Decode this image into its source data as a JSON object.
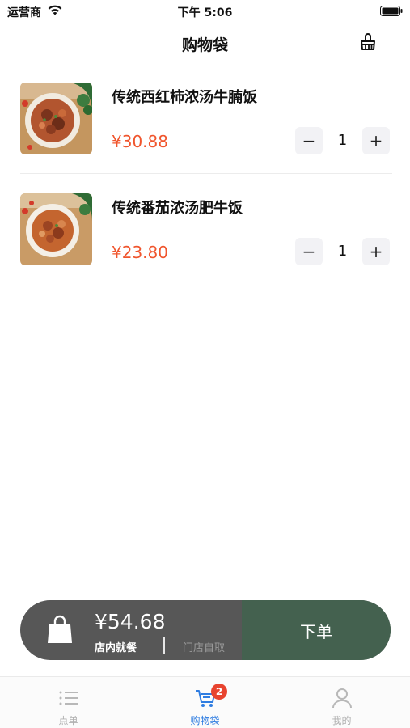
{
  "status_bar": {
    "carrier": "运营商",
    "time": "下午 5:06"
  },
  "header": {
    "title": "购物袋",
    "clear_icon": "broom-icon"
  },
  "cart": {
    "items": [
      {
        "name": "传统西红柿浓汤牛腩饭",
        "price": "¥30.88",
        "quantity": "1",
        "minus_label": "−",
        "plus_label": "+"
      },
      {
        "name": "传统番茄浓汤肥牛饭",
        "price": "¥23.80",
        "quantity": "1",
        "minus_label": "−",
        "plus_label": "+"
      }
    ]
  },
  "checkout": {
    "total": "¥54.68",
    "dine_in_label": "店内就餐",
    "takeout_label": "门店自取",
    "order_label": "下单",
    "bag_icon": "shopping-bag-icon"
  },
  "tab_bar": {
    "tabs": [
      {
        "label": "点单",
        "icon": "list-icon"
      },
      {
        "label": "购物袋",
        "icon": "cart-icon",
        "badge": "2"
      },
      {
        "label": "我的",
        "icon": "user-icon"
      }
    ],
    "active_index": 1
  },
  "colors": {
    "price": "#f0552d",
    "order_button": "#44614f",
    "checkout_bg": "#575757",
    "active_tab": "#2f7de1",
    "badge": "#e8442f"
  }
}
